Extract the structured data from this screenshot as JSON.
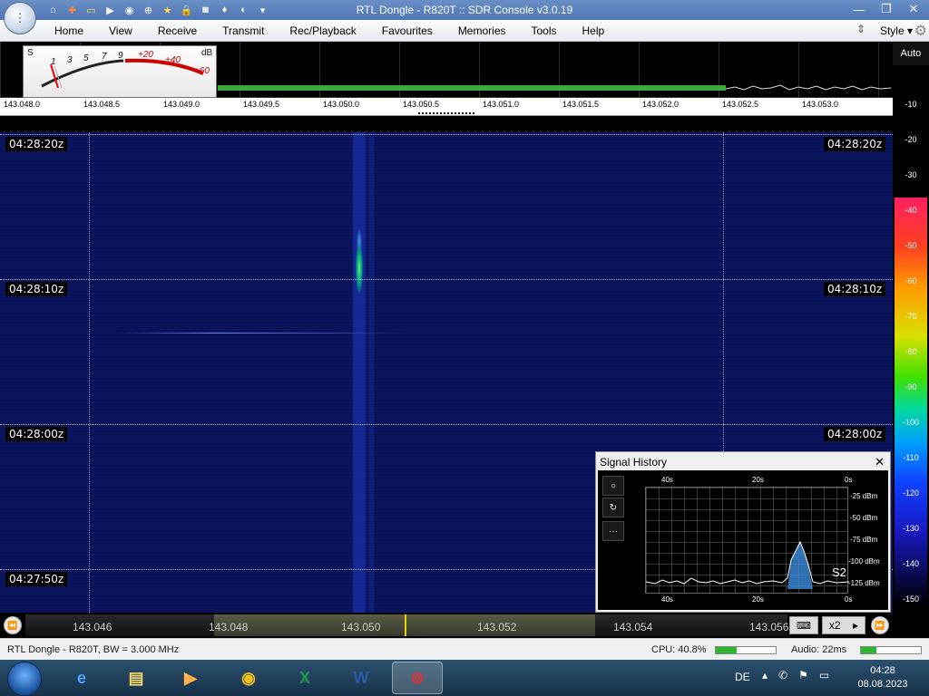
{
  "window": {
    "title": "RTL Dongle - R820T :: SDR Console v3.0.19",
    "controls": {
      "minimize": "—",
      "maximize": "❐",
      "close": "✕"
    }
  },
  "quick_access": [
    "home-icon",
    "settings-icon",
    "folder-icon",
    "play-icon",
    "stop-icon",
    "add-icon",
    "star-icon",
    "lock-icon",
    "camera-icon",
    "drop-icon",
    "help-icon",
    "more-icon"
  ],
  "menu": {
    "items": [
      "Home",
      "View",
      "Receive",
      "Transmit",
      "Rec/Playback",
      "Favourites",
      "Memories",
      "Tools",
      "Help"
    ],
    "style_label": "Style"
  },
  "smeter": {
    "s_label": "S",
    "db_label": "dB",
    "s_ticks": [
      "1",
      "3",
      "5",
      "7",
      "9"
    ],
    "db_ticks": [
      "+20",
      "+40",
      "+60"
    ]
  },
  "spectrum": {
    "auto_label": "Auto",
    "freq_ticks": [
      "143.048.0",
      "143.048.5",
      "143.049.0",
      "143.049.5",
      "143.050.0",
      "143.050.5",
      "143.051.0",
      "143.051.5",
      "143.052.0",
      "143.052.5",
      "143.053.0"
    ]
  },
  "db_scale": [
    "-10",
    "-20",
    "-30",
    "-40",
    "-50",
    "-60",
    "-70",
    "-80",
    "-90",
    "-100",
    "-110",
    "-120",
    "-130",
    "-140",
    "-150"
  ],
  "waterfall": {
    "time_labels": [
      "04:28:20z",
      "04:28:10z",
      "04:28:00z",
      "04:27:50z"
    ]
  },
  "signal_history": {
    "title": "Signal History",
    "close": "✕",
    "top_axis": [
      "40s",
      "20s",
      "0s"
    ],
    "bottom_axis": [
      "40s",
      "20s",
      "0s"
    ],
    "y_axis": [
      "-25 dBm",
      "-50 dBm",
      "-75 dBm",
      "-100 dBm",
      "-125 dBm"
    ],
    "s_reading": "S2",
    "buttons": [
      "○",
      "↻",
      "···"
    ]
  },
  "bottom_freq": {
    "labels": [
      "143.046",
      "143.048",
      "143.050",
      "143.052",
      "143.054",
      "143.056"
    ],
    "zoom": "x2",
    "kbd_icon": "keyboard-icon"
  },
  "status_bar": {
    "device": "RTL Dongle - R820T, BW = 3.000 MHz",
    "cpu": "CPU: 40.8%",
    "audio": "Audio: 22ms",
    "cpu_level": 0.35,
    "audio_level": 0.25
  },
  "taskbar": {
    "apps": [
      "ie-icon",
      "explorer-icon",
      "media-icon",
      "chrome-icon",
      "excel-icon",
      "word-icon",
      "sdr-console-icon"
    ],
    "lang": "DE",
    "time": "04:28",
    "date": "08.08.2023"
  }
}
